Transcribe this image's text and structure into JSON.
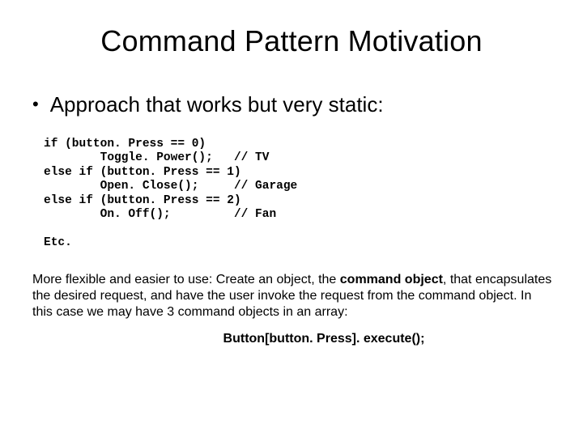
{
  "title": "Command Pattern Motivation",
  "bullet": "Approach that works but very static:",
  "code": "if (button. Press == 0)\n        Toggle. Power();   // TV\nelse if (button. Press == 1)\n        Open. Close();     // Garage\nelse if (button. Press == 2)\n        On. Off();         // Fan",
  "etc": "Etc.",
  "para_prefix": "More flexible and easier to use:  Create an object, the ",
  "para_bold": "command object",
  "para_suffix": ", that encapsulates the desired request, and have the user invoke the request from the command object.  In this case we may have 3 command objects in an array:",
  "exec": "Button[button. Press]. execute();"
}
